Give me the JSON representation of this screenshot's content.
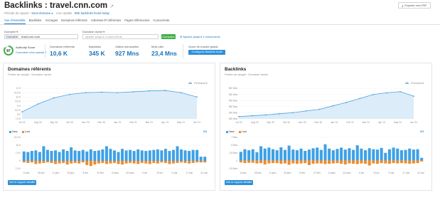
{
  "header": {
    "title_prefix": "Backlinks :",
    "domain": "travel.cnn.com",
    "scope_label": "Période du rapport :",
    "scope_value": "Sous-domaine",
    "update_label": "Live Update :",
    "update_value": "68K backlinks found today",
    "export_label": "Exporter vers PDF"
  },
  "tabs": [
    "Vue d'ensemble",
    "Backlinks",
    "Ancrages",
    "Domaines référents",
    "Adresses IP référentes",
    "Pages référencées",
    "Concurrents"
  ],
  "search": {
    "domain_label": "Domaine",
    "domain_value": "travel.cnn.com",
    "type_label": "Domaine racine",
    "type_placeholder": "Ajouter jusqu'à 4 concurrents",
    "compare_label": "Comparer",
    "competitors_link": "Ajoutez jusqu'à 4 concurrents"
  },
  "metrics": {
    "authority_label": "Authority Score",
    "authority_value": "87",
    "authority_link": "Comment c'est calculé ?",
    "domains_label": "Domaines référents",
    "domains_value": "10,6 K",
    "backlinks_label": "Backlinks",
    "backlinks_value": "345 K",
    "visits_label": "Visites mensuelles",
    "visits_value": "927 Mns",
    "keywords_label": "Mots clés",
    "keywords_value": "23,4 Mns",
    "toxicity_label": "Score de toxicité global",
    "toxicity_button": "Configurez Backlink Audit"
  },
  "left_panel": {
    "title": "Domaines référents",
    "subtitle": "Portée du widget : Domaine racine",
    "range_1y": "1A",
    "range_all": "Permanent",
    "legend_new": "New",
    "legend_lost": "Lost",
    "granularity": "6M",
    "report_button": "Voir le rapport détaillé"
  },
  "right_panel": {
    "title": "Backlinks",
    "subtitle": "Portée du widget : Domaine racine",
    "range_1y": "1A",
    "range_all": "Permanent",
    "legend_new": "New",
    "legend_lost": "Lost",
    "granularity": "6M",
    "report_button": "Voir le rapport détaillé"
  },
  "colors": {
    "accent": "#2f90d8",
    "new_bar": "#3ea1e6",
    "lost_bar": "#f28b26",
    "area_fill": "#dcecf9",
    "area_line": "#4aa3df",
    "score_ring": "#42b04a"
  },
  "chart_data": [
    {
      "type": "area",
      "title": "Domaines référents",
      "x_tick_labels": [
        "Jul '20",
        "Aug '20",
        "Sep '20",
        "Oct '20",
        "Nov '20",
        "Dec '20",
        "Jan '21",
        "Feb '21",
        "Mar '21",
        "Apr '21",
        "May '21",
        "Jun '21"
      ],
      "y_tick_labels": [
        "7,5 K",
        "8 K",
        "8,5 K",
        "9 K",
        "9,5 K",
        "10 K",
        "10,5 K",
        "11 K"
      ],
      "ylim": [
        7500,
        11000
      ],
      "values": [
        8300,
        9200,
        9900,
        10300,
        10500,
        10550,
        10500,
        10600,
        10700,
        10750,
        10500,
        10000
      ],
      "range": "1A"
    },
    {
      "type": "bar",
      "title": "Domaines référents New / Lost",
      "x_tick_labels": [
        "14 déc",
        "28 déc",
        "11 janv",
        "25 janv",
        "8 févr",
        "22 févr",
        "8 mars",
        "22 mars",
        "5 avr",
        "19 avr",
        "3 mai",
        "17 mai",
        "31 mai"
      ],
      "y_tick_labels": [
        "22,5 K",
        "15 K",
        "7,5 K",
        "0",
        "-7,5 K"
      ],
      "ylim": [
        -7500,
        22500
      ],
      "series": [
        {
          "name": "New",
          "values": [
            9000,
            8500,
            9500,
            10000,
            8500,
            14000,
            10500,
            9500,
            10000,
            8500,
            11000,
            9500,
            13000,
            10000,
            9500,
            10500,
            9000,
            11000,
            9500,
            10000,
            11000,
            14000,
            11500,
            10000,
            8500,
            11500,
            10000,
            10500,
            9500,
            11000,
            10000,
            9500,
            10000,
            10500,
            11000,
            10000,
            11500,
            9500,
            10500,
            14000,
            11000,
            10000,
            9500,
            10500,
            10500,
            4000,
            4000
          ]
        },
        {
          "name": "Lost",
          "values": [
            -1500,
            -2000,
            -1500,
            -3000,
            -2500,
            -2000,
            -1500,
            -2000,
            -3000,
            -2500,
            -2000,
            -3500,
            -2500,
            -2000,
            -2500,
            -1500,
            -4000,
            -5000,
            -3500,
            -2500,
            -2000,
            -3000,
            -2500,
            -2000,
            -3000,
            -3500,
            -2500,
            -2000,
            -2500,
            -3000,
            -2000,
            -2500,
            -3000,
            -2000,
            -2500,
            -1500,
            -2000,
            -3000,
            -2500,
            -2000,
            -1500,
            -2000,
            -2500,
            -2000,
            -1500,
            -1500,
            -1500
          ]
        }
      ]
    },
    {
      "type": "area",
      "title": "Backlinks",
      "x_tick_labels": [
        "Jul '20",
        "Aug '20",
        "Sep '20",
        "Oct '20",
        "Nov '20",
        "Dec '20",
        "Jan '21",
        "Feb '21",
        "Mar '21",
        "Apr '21",
        "May '21",
        "Jun '21"
      ],
      "y_tick_labels": [
        "250 Mns",
        "300 Mns",
        "350 Mns",
        "400 Mns",
        "450 Mns",
        "500 Mns"
      ],
      "ylim": [
        250000,
        520000
      ],
      "values": [
        270000,
        278000,
        285000,
        295000,
        305000,
        320000,
        335000,
        365000,
        395000,
        430000,
        465000,
        480000,
        490000,
        450000
      ],
      "range": "1A"
    },
    {
      "type": "bar",
      "title": "Backlinks New / Lost",
      "x_tick_labels": [
        "14 déc",
        "28 déc",
        "11 janv",
        "25 janv",
        "8 févr",
        "22 févr",
        "8 mars",
        "22 mars",
        "5 avr",
        "19 avr",
        "3 mai",
        "17 mai",
        "31 mai"
      ],
      "y_tick_labels": [
        "7 Mns",
        "5 Mns",
        "2,5 Mns",
        "0",
        "-2,5 Mns"
      ],
      "ylim": [
        -2500000,
        7000000
      ],
      "series": [
        {
          "name": "New",
          "values": [
            2600000,
            3400000,
            3100000,
            3400000,
            2500000,
            4300000,
            3600000,
            3900000,
            3400000,
            3100000,
            4000000,
            3200000,
            4500000,
            3300000,
            3100000,
            3600000,
            2900000,
            3300000,
            3700000,
            3900000,
            3200000,
            4900000,
            3600000,
            3100000,
            3500000,
            3900000,
            3300000,
            3700000,
            3200000,
            4600000,
            3600000,
            3100000,
            3700000,
            3400000,
            3300000,
            3800000,
            2300000,
            3400000,
            3900000,
            3600000,
            3100000,
            3200000,
            3600000,
            3300000,
            3400000,
            800000
          ]
        },
        {
          "name": "Lost",
          "values": [
            -600000,
            -800000,
            -700000,
            -700000,
            -900000,
            -800000,
            -1200000,
            -900000,
            -800000,
            -800000,
            -1000000,
            -900000,
            -1300000,
            -900000,
            -1000000,
            -900000,
            -800000,
            -1400000,
            -1000000,
            -900000,
            -900000,
            -1100000,
            -1000000,
            -900000,
            -800000,
            -1000000,
            -1200000,
            -900000,
            -1000000,
            -1100000,
            -900000,
            -1000000,
            -1500000,
            -900000,
            -1000000,
            -800000,
            -900000,
            -1000000,
            -800000,
            -900000,
            -800000,
            -900000,
            -1000000,
            -900000,
            -800000,
            -300000
          ]
        }
      ]
    }
  ]
}
